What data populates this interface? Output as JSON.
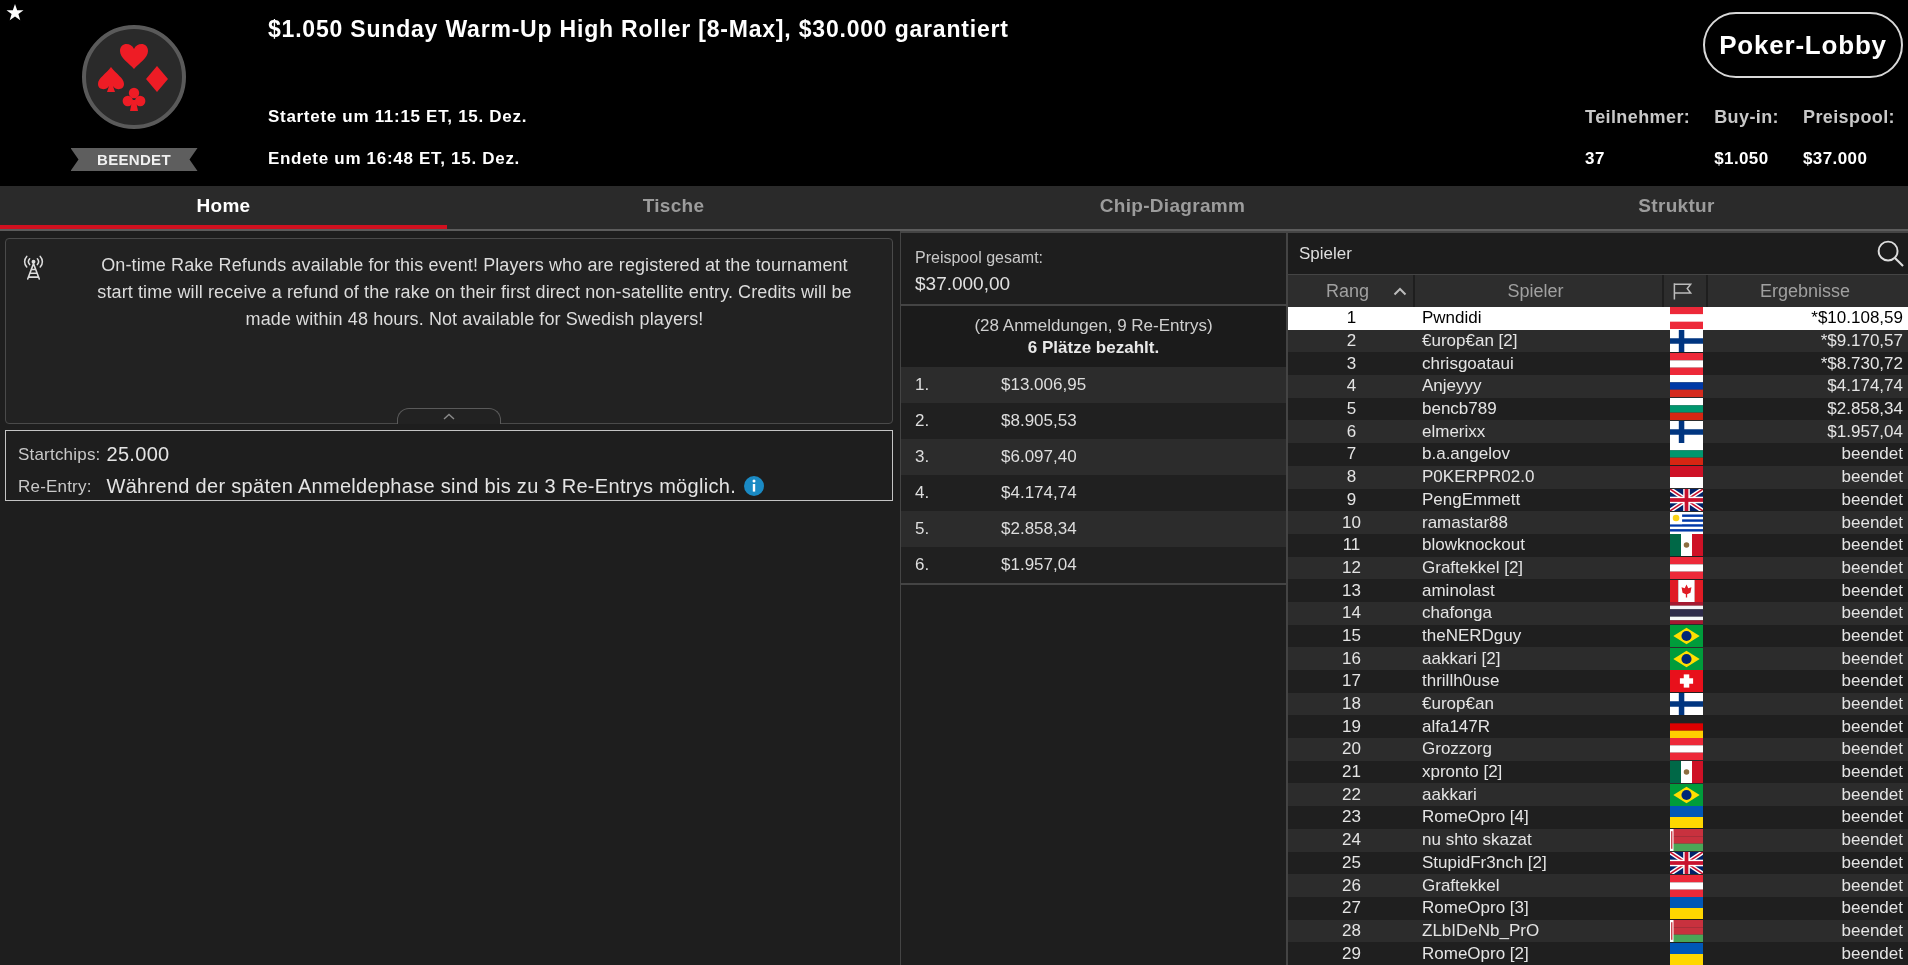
{
  "tournament": {
    "title": "$1.050 Sunday Warm-Up High Roller [8-Max], $30.000 garantiert",
    "status": "BEENDET",
    "started": "Startete um 11:15 ET, 15. Dez.",
    "ended": "Endete um 16:48 ET, 15. Dez."
  },
  "lobby_button": "Poker-Lobby",
  "stats": [
    {
      "label": "Teilnehmer:",
      "value": "37"
    },
    {
      "label": "Buy-in:",
      "value": "$1.050"
    },
    {
      "label": "Preispool:",
      "value": "$37.000"
    }
  ],
  "tabs": [
    {
      "label": "Home",
      "selected": true
    },
    {
      "label": "Tische",
      "selected": false
    },
    {
      "label": "Chip-Diagramm",
      "selected": false
    },
    {
      "label": "Struktur",
      "selected": false
    }
  ],
  "notice": "On-time Rake Refunds available for this event! Players who are registered at the tournament start time will receive a refund of the rake on their first direct non-satellite entry. Credits will be made within 48 hours. Not available for Swedish players!",
  "details": [
    {
      "label": "Startchips:",
      "value": "25.000",
      "info": false
    },
    {
      "label": "Re-Entry:",
      "value": "Während der späten Anmeldephase sind bis zu 3 Re-Entrys möglich.",
      "info": true
    }
  ],
  "prize_pool": {
    "label": "Preispool gesamt:",
    "total": "$37.000,00",
    "entries": "(28 Anmeldungen, 9 Re-Entrys)",
    "paid": "6 Plätze bezahlt.",
    "payouts": [
      {
        "place": "1.",
        "amount": "$13.006,95"
      },
      {
        "place": "2.",
        "amount": "$8.905,53"
      },
      {
        "place": "3.",
        "amount": "$6.097,40"
      },
      {
        "place": "4.",
        "amount": "$4.174,74"
      },
      {
        "place": "5.",
        "amount": "$2.858,34"
      },
      {
        "place": "6.",
        "amount": "$1.957,04"
      }
    ]
  },
  "players": {
    "title": "Spieler",
    "columns": [
      {
        "kind": "text",
        "label": "Rang",
        "sorted": true
      },
      {
        "kind": "text",
        "label": "Spieler",
        "sorted": false
      },
      {
        "kind": "flag",
        "sorted": false
      },
      {
        "kind": "text",
        "label": "Ergebnisse",
        "sorted": false
      }
    ],
    "rows": [
      {
        "rank": "1",
        "name": "Pwndidi",
        "kind": "at",
        "result": "*$10.108,59",
        "selected": true
      },
      {
        "rank": "2",
        "name": "€urop€an [2]",
        "kind": "fi",
        "result": "*$9.170,57",
        "selected": false
      },
      {
        "rank": "3",
        "name": "chrisgoataui",
        "kind": "at",
        "result": "*$8.730,72",
        "selected": false
      },
      {
        "rank": "4",
        "name": "Anjeyyy",
        "kind": "ru",
        "result": "$4.174,74",
        "selected": false
      },
      {
        "rank": "5",
        "name": "bencb789",
        "kind": "bg",
        "result": "$2.858,34",
        "selected": false
      },
      {
        "rank": "6",
        "name": "elmerixx",
        "kind": "fi",
        "result": "$1.957,04",
        "selected": false
      },
      {
        "rank": "7",
        "name": "b.a.angelov",
        "kind": "bg",
        "result": "beendet",
        "selected": false
      },
      {
        "rank": "8",
        "name": "P0KERPR02.0",
        "kind": "mc",
        "result": "beendet",
        "selected": false
      },
      {
        "rank": "9",
        "name": "PengEmmett",
        "kind": "gb",
        "result": "beendet",
        "selected": false
      },
      {
        "rank": "10",
        "name": "ramastar88",
        "kind": "uy",
        "result": "beendet",
        "selected": false
      },
      {
        "rank": "11",
        "name": "blowknockout",
        "kind": "mx",
        "result": "beendet",
        "selected": false
      },
      {
        "rank": "12",
        "name": "Graftekkel [2]",
        "kind": "at",
        "result": "beendet",
        "selected": false
      },
      {
        "rank": "13",
        "name": "aminolast",
        "kind": "ca",
        "result": "beendet",
        "selected": false
      },
      {
        "rank": "14",
        "name": "chafonga",
        "kind": "th",
        "result": "beendet",
        "selected": false
      },
      {
        "rank": "15",
        "name": "theNERDguy",
        "kind": "br",
        "result": "beendet",
        "selected": false
      },
      {
        "rank": "16",
        "name": "aakkari [2]",
        "kind": "br",
        "result": "beendet",
        "selected": false
      },
      {
        "rank": "17",
        "name": "thrillh0use",
        "kind": "ch",
        "result": "beendet",
        "selected": false
      },
      {
        "rank": "18",
        "name": "€urop€an",
        "kind": "fi",
        "result": "beendet",
        "selected": false
      },
      {
        "rank": "19",
        "name": "alfa147R",
        "kind": "de",
        "result": "beendet",
        "selected": false
      },
      {
        "rank": "20",
        "name": "Grozzorg",
        "kind": "at",
        "result": "beendet",
        "selected": false
      },
      {
        "rank": "21",
        "name": "xpronto [2]",
        "kind": "mx",
        "result": "beendet",
        "selected": false
      },
      {
        "rank": "22",
        "name": "aakkari",
        "kind": "br",
        "result": "beendet",
        "selected": false
      },
      {
        "rank": "23",
        "name": "RomeOpro [4]",
        "kind": "ua",
        "result": "beendet",
        "selected": false
      },
      {
        "rank": "24",
        "name": "nu shto skazat",
        "kind": "by",
        "result": "beendet",
        "selected": false
      },
      {
        "rank": "25",
        "name": "StupidFr3nch [2]",
        "kind": "gb",
        "result": "beendet",
        "selected": false
      },
      {
        "rank": "26",
        "name": "Graftekkel",
        "kind": "at",
        "result": "beendet",
        "selected": false
      },
      {
        "rank": "27",
        "name": "RomeOpro [3]",
        "kind": "ua",
        "result": "beendet",
        "selected": false
      },
      {
        "rank": "28",
        "name": "ZLbIDeNb_PrO",
        "kind": "by",
        "result": "beendet",
        "selected": false
      },
      {
        "rank": "29",
        "name": "RomeOpro [2]",
        "kind": "ua",
        "result": "beendet",
        "selected": false
      }
    ]
  }
}
